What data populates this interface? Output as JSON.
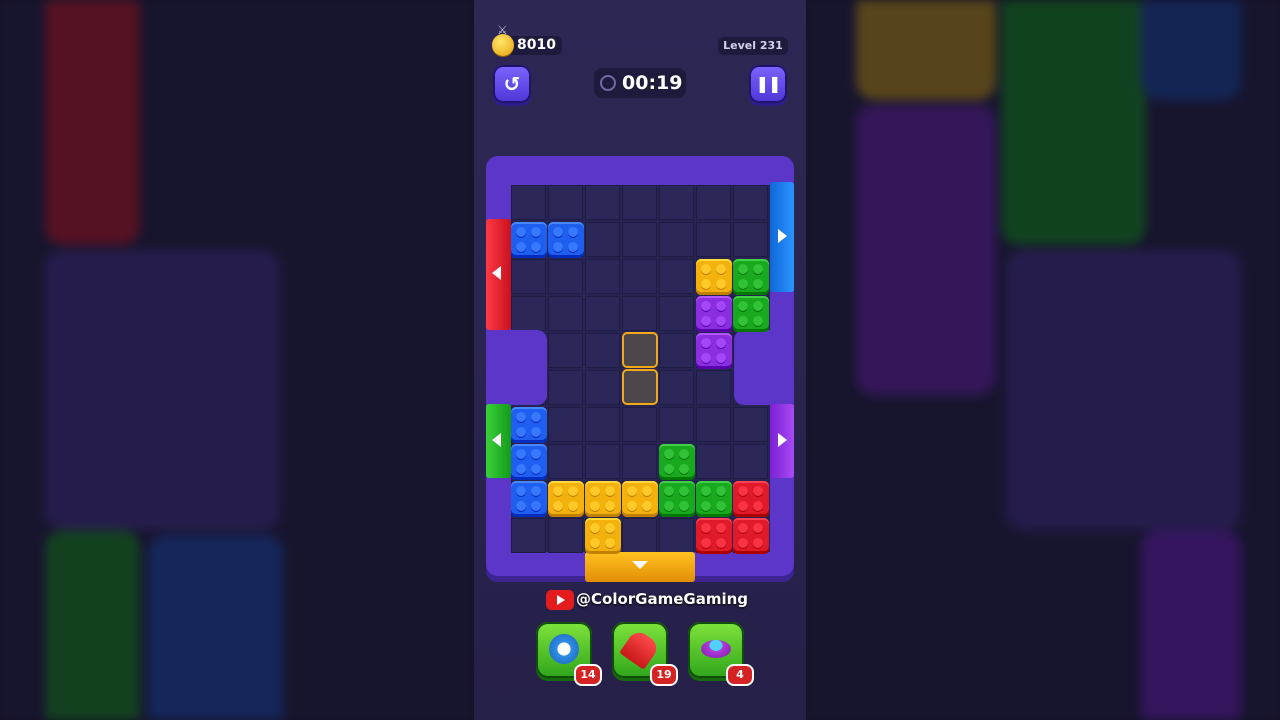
{
  "hud": {
    "coins": "8010",
    "level": "Level 231",
    "timer": "00:19"
  },
  "watermark": {
    "handle": "@ColorGameGaming"
  },
  "powerups": [
    {
      "icon": "alarm-clock-icon",
      "count": "14"
    },
    {
      "icon": "rocket-icon",
      "count": "19"
    },
    {
      "icon": "ufo-icon",
      "count": "4"
    }
  ],
  "colors": {
    "blue": "#1f5ff0",
    "red": "#e0192b",
    "green": "#18a91f",
    "yellow": "#f3b10e",
    "purple": "#8b2ee0",
    "board_frame": "#5b36c9"
  }
}
